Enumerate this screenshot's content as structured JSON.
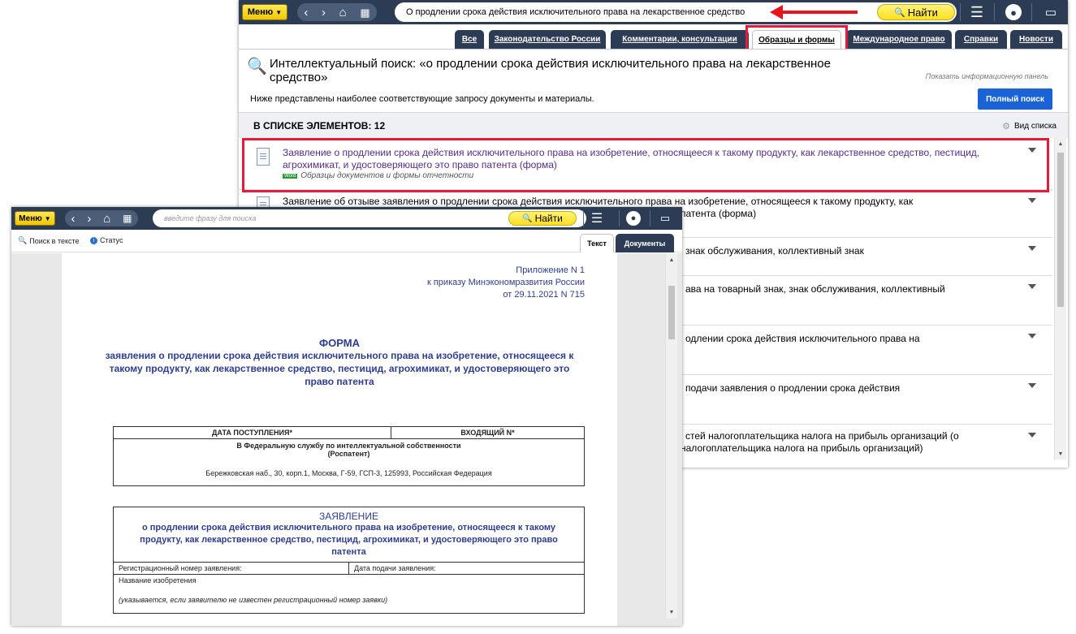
{
  "back_window": {
    "toolbar": {
      "menu_label": "Меню",
      "search_value": "О продлении срока действия исключительного права на лекарственное средство",
      "find_label": "Найти"
    },
    "tabs": [
      {
        "label": "Все"
      },
      {
        "label": "Законодательство России"
      },
      {
        "label": "Комментарии, консультации"
      },
      {
        "label": "Образцы и формы"
      },
      {
        "label": "Международное право"
      },
      {
        "label": "Справки"
      },
      {
        "label": "Новости"
      }
    ],
    "search_header": {
      "title": "Интеллектуальный поиск: «о продлении срока действия исключительного права на лекарственное средство»",
      "info_panel_link": "Показать информационную панель",
      "subtitle": "Ниже представлены наиболее соответствующие запросу документы и материалы.",
      "full_search_button": "Полный поиск"
    },
    "list": {
      "count_label": "В СПИСКЕ ЭЛЕМЕНТОВ: 12",
      "view_label": "Вид списка",
      "items": [
        {
          "title": "Заявление о продлении срока действия исключительного права на изобретение, относящееся к такому продукту, как лекарственное средство, пестицид, агрохимикат, и удостоверяющего это право патента (форма)",
          "badge": "Word",
          "category": "Образцы документов и формы отчетности"
        },
        {
          "title": "Заявление об отзыве заявления о продлении срока действия исключительного права на изобретение, относящееся к такому продукту, как",
          "title2": "патента (форма)"
        },
        {
          "title": "знак обслуживания, коллективный знак"
        },
        {
          "title": "ава на товарный знак, знак обслуживания, коллективный"
        },
        {
          "title": "одлении срока действия исключительного права на"
        },
        {
          "title": "подачи заявления о продлении срока действия"
        },
        {
          "title": "стей налогоплательщика налога на прибыль организаций (о",
          "title2": "налогоплательщика налога на прибыль организаций)"
        }
      ]
    }
  },
  "front_window": {
    "toolbar": {
      "menu_label": "Меню",
      "search_placeholder": "введите фразу для поиска",
      "find_label": "Найти"
    },
    "subbar": {
      "search_in_text": "Поиск в тексте",
      "status": "Статус"
    },
    "tabs": [
      {
        "label": "Текст"
      },
      {
        "label": "Документы"
      }
    ],
    "document": {
      "appendix_line1": "Приложение N 1",
      "appendix_line2": "к приказу Минэкономразвития России",
      "appendix_line3": "от 29.11.2021 N 715",
      "form_heading": "ФОРМА",
      "form_subheading": "заявления о продлении срока действия исключительного права на изобретение, относящееся к такому продукту, как лекарственное средство, пестицид, агрохимикат, и удостоверяющего это право патента",
      "table1": {
        "col1": "ДАТА ПОСТУПЛЕНИЯ*",
        "col2": "ВХОДЯЩИЙ N*",
        "agency": "В Федеральную службу по интеллектуальной собственности",
        "agency_short": "(Роспатент)",
        "address": "Бережковская наб., 30, корп.1, Москва, Г-59, ГСП-3, 125993, Российская Федерация"
      },
      "table2": {
        "heading": "ЗАЯВЛЕНИЕ",
        "text": "о продлении срока действия исключительного права на изобретение, относящееся к такому продукту, как лекарственное средство, пестицид, агрохимикат, и удостоверяющего это право патента",
        "reg_number": "Регистрационный номер заявления:",
        "filing_date": "Дата подачи заявления:",
        "invention_name": "Название изобретения",
        "note": "(указывается, если заявителю не известен регистрационный номер заявки)"
      }
    }
  },
  "colors": {
    "toolbar": "#2b3c54",
    "highlight_frame": "#e41c3b",
    "arrow": "#e8141c",
    "link_purple": "#5b2a86",
    "doc_blue": "#2f3d8f",
    "primary_button": "#1a63d6"
  }
}
